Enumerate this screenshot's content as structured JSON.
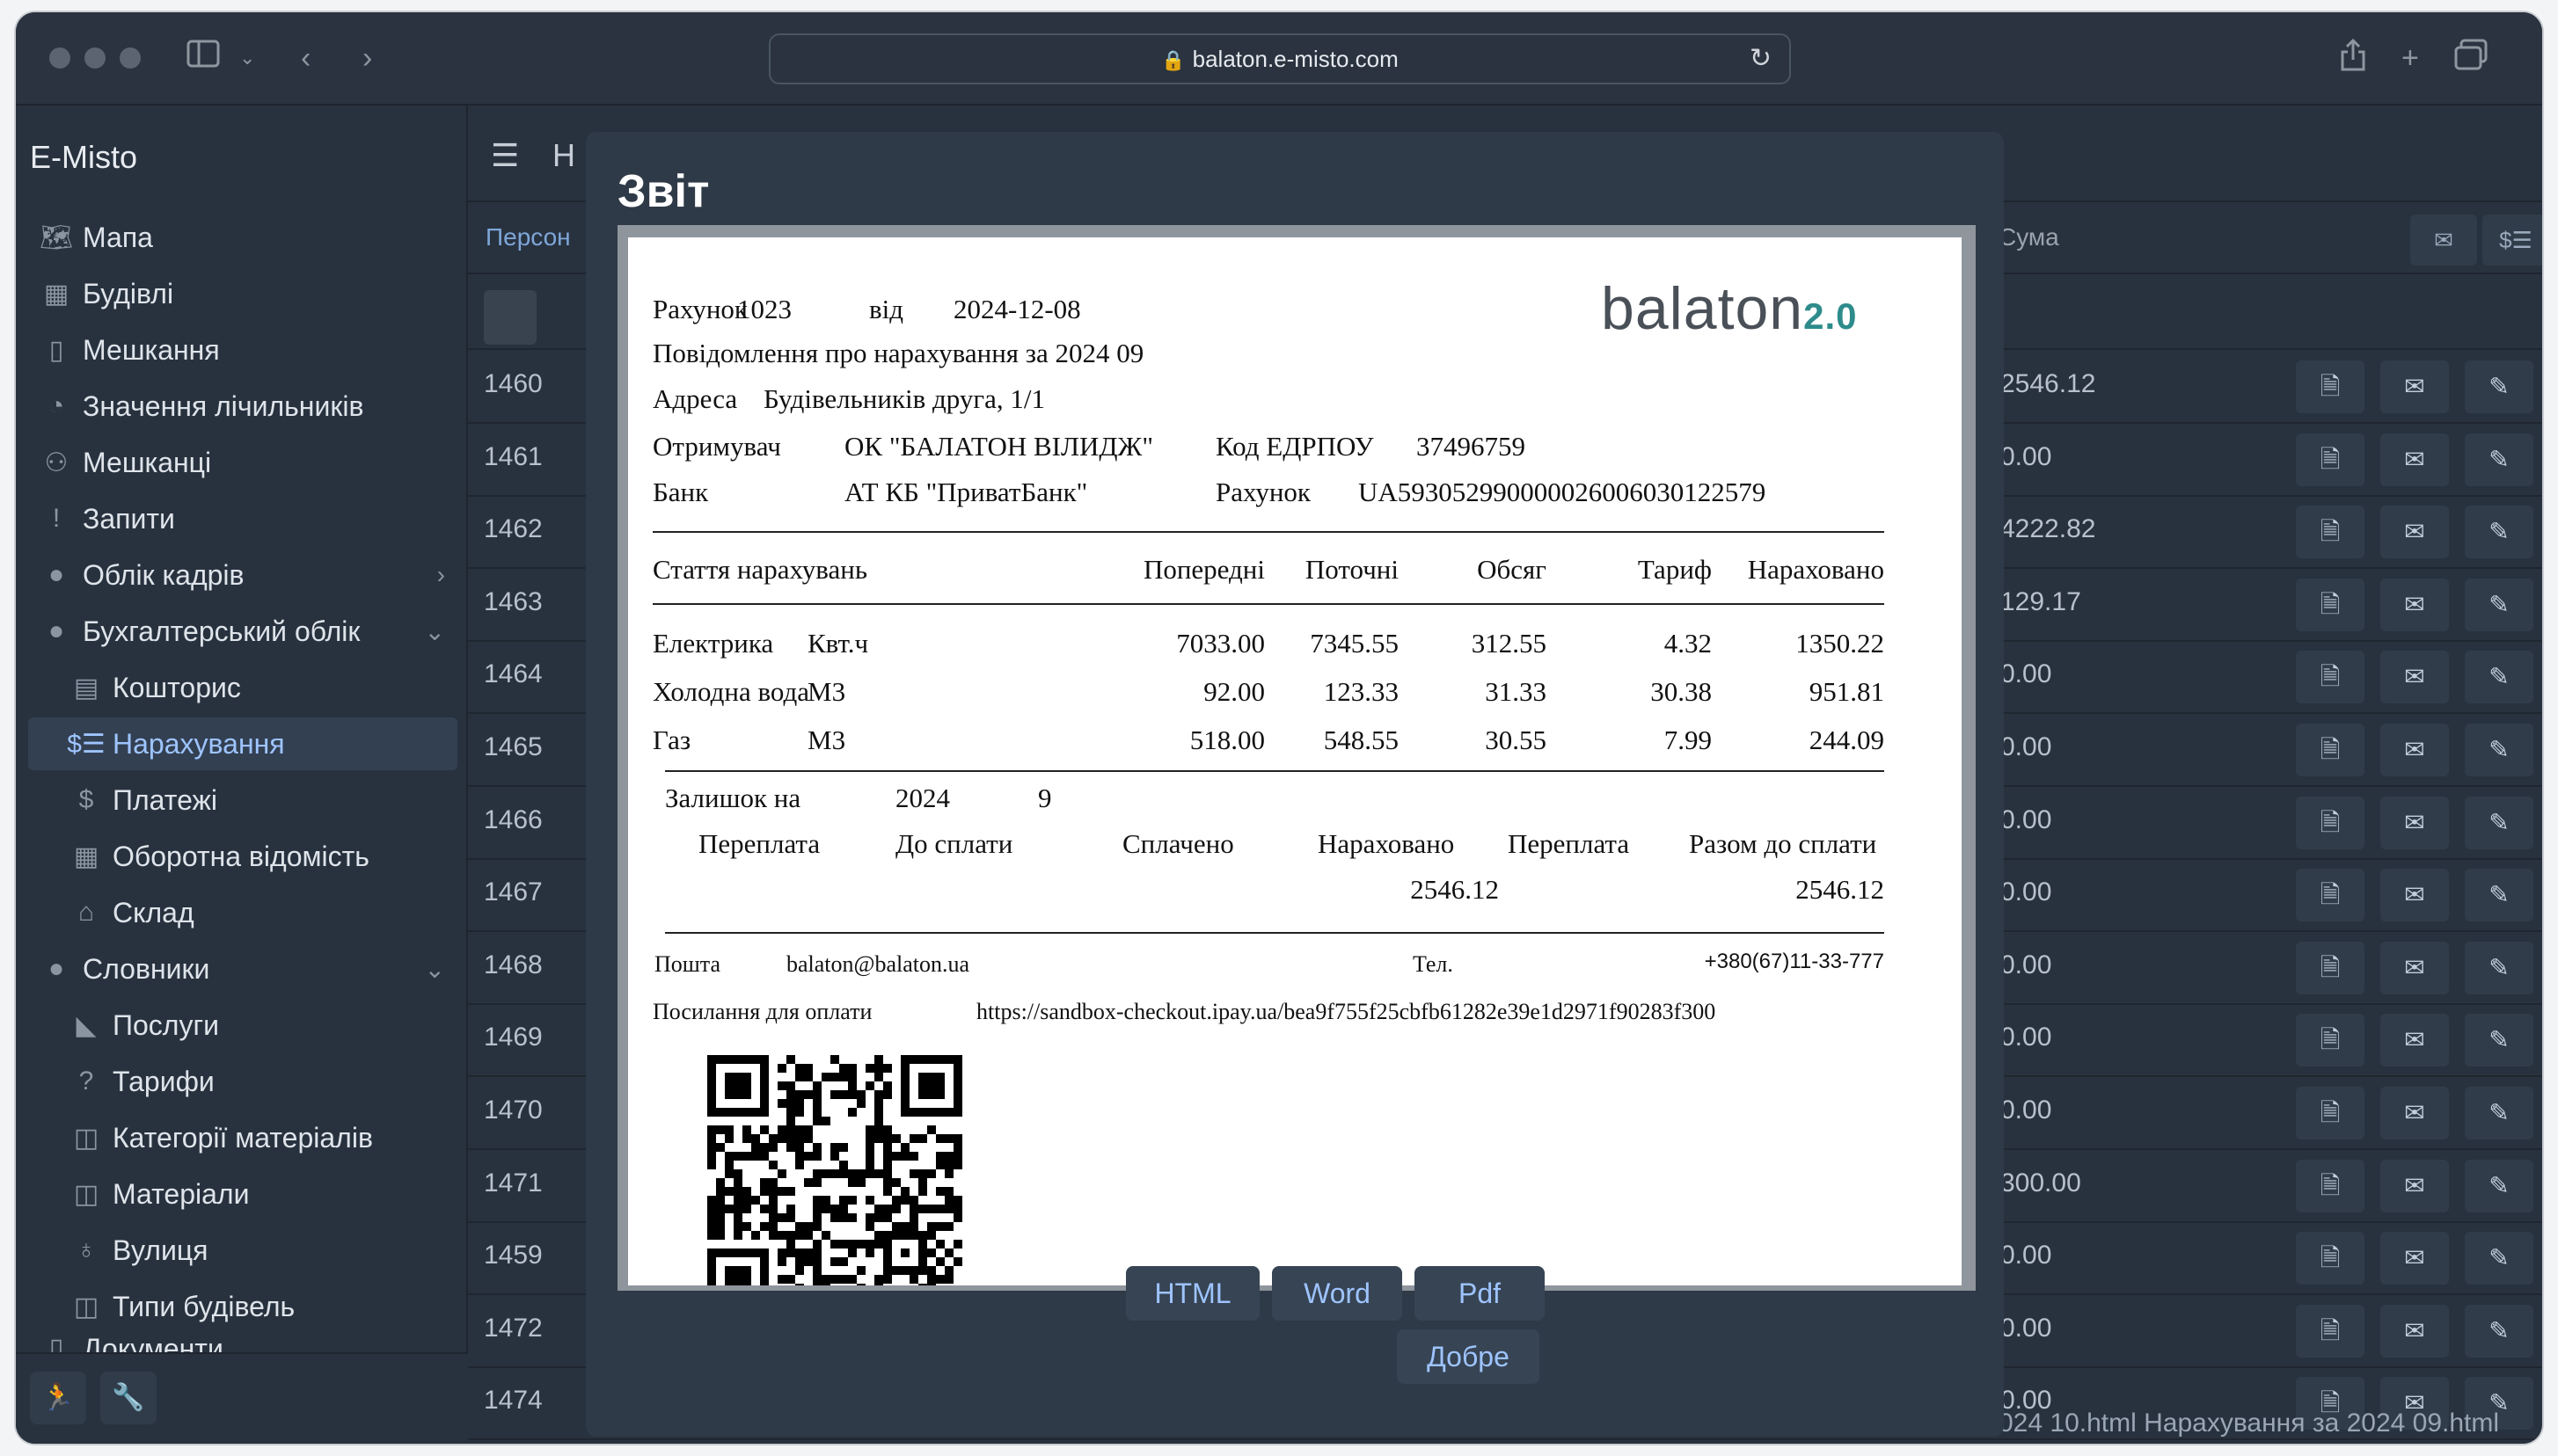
{
  "browser": {
    "url": "balaton.e-misto.com"
  },
  "sidebar": {
    "app_title": "E-Misto",
    "items": [
      {
        "label": "Мапа",
        "icon": "map-icon"
      },
      {
        "label": "Будівлі",
        "icon": "building-icon"
      },
      {
        "label": "Мешкання",
        "icon": "door-icon"
      },
      {
        "label": "Значення лічильників",
        "icon": "gauge-icon"
      },
      {
        "label": "Мешканці",
        "icon": "people-icon"
      },
      {
        "label": "Запити",
        "icon": "exclamation-icon"
      },
      {
        "label": "Облік кадрів",
        "icon": "globe-icon"
      },
      {
        "label": "Бухгалтерський облік",
        "icon": "globe-icon"
      },
      {
        "label": "Кошторис",
        "icon": "estimate-icon"
      },
      {
        "label": "Нарахування",
        "icon": "invoice-icon"
      },
      {
        "label": "Платежі",
        "icon": "dollar-icon"
      },
      {
        "label": "Оборотна відомість",
        "icon": "table-icon"
      },
      {
        "label": "Склад",
        "icon": "warehouse-icon"
      },
      {
        "label": "Словники",
        "icon": "globe-icon"
      },
      {
        "label": "Послуги",
        "icon": "service-icon"
      },
      {
        "label": "Тарифи",
        "icon": "question-icon"
      },
      {
        "label": "Категорії матеріалів",
        "icon": "panel-icon"
      },
      {
        "label": "Матеріали",
        "icon": "panel-icon"
      },
      {
        "label": "Вулиця",
        "icon": "street-icon"
      },
      {
        "label": "Типи будівель",
        "icon": "panel-icon"
      }
    ],
    "partial_item": "Документи"
  },
  "main": {
    "header_partial": "Н",
    "columns": {
      "person": "Персон",
      "sum": "Сума"
    },
    "rows": [
      {
        "id": "1460",
        "sum": "2546.12"
      },
      {
        "id": "1461",
        "sum": "0.00"
      },
      {
        "id": "1462",
        "sum": "4222.82"
      },
      {
        "id": "1463",
        "sum": "129.17"
      },
      {
        "id": "1464",
        "sum": "0.00"
      },
      {
        "id": "1465",
        "sum": "0.00"
      },
      {
        "id": "1466",
        "sum": "0.00"
      },
      {
        "id": "1467",
        "sum": "0.00"
      },
      {
        "id": "1468",
        "sum": "0.00"
      },
      {
        "id": "1469",
        "sum": "0.00"
      },
      {
        "id": "1470",
        "sum": "0.00"
      },
      {
        "id": "1471",
        "sum": "300.00"
      },
      {
        "id": "1459",
        "sum": "0.00"
      },
      {
        "id": "1472",
        "sum": "0.00"
      },
      {
        "id": "1474",
        "sum": "0.00"
      }
    ],
    "status_line": "024 10.html  Нарахування за 2024 09.html"
  },
  "modal": {
    "title": "Звіт",
    "buttons": {
      "html": "HTML",
      "word": "Word",
      "pdf": "Pdf",
      "ok": "Добре"
    }
  },
  "report": {
    "logo_text": "balaton",
    "logo_version": "2.0",
    "invoice_label": "Рахунок",
    "invoice_no": "1023",
    "from_label": "від",
    "date": "2024-12-08",
    "notice": "Повідомлення про нарахування за 2024 09",
    "address_label": "Адреса",
    "address": "Будівельників друга, 1/1",
    "recipient_label": "Отримувач",
    "recipient": "ОК \"БАЛАТОН ВІЛИДЖ\"",
    "edrpou_label": "Код ЕДРПОУ",
    "edrpou": "37496759",
    "bank_label": "Банк",
    "bank": "АТ КБ \"ПриватБанк\"",
    "account_label": "Рахунок",
    "account": "UA593052990000026006030122579",
    "table_headers": [
      "Стаття нарахувань",
      "Попередні",
      "Поточні",
      "Обсяг",
      "Тариф",
      "Нараховано"
    ],
    "charges": [
      {
        "name": "Електрика",
        "unit": "Квт.ч",
        "prev": "7033.00",
        "curr": "7345.55",
        "volume": "312.55",
        "tariff": "4.32",
        "charged": "1350.22"
      },
      {
        "name": "Холодна вода",
        "unit": "М3",
        "prev": "92.00",
        "curr": "123.33",
        "volume": "31.33",
        "tariff": "30.38",
        "charged": "951.81"
      },
      {
        "name": "Газ",
        "unit": "М3",
        "prev": "518.00",
        "curr": "548.55",
        "volume": "30.55",
        "tariff": "7.99",
        "charged": "244.09"
      }
    ],
    "balance_label": "Залишок на",
    "balance_year": "2024",
    "balance_month": "9",
    "balance_headers": [
      "Переплата",
      "До сплати",
      "Сплачено",
      "Нараховано",
      "Переплата",
      "Разом до сплати"
    ],
    "balance_charged": "2546.12",
    "balance_total": "2546.12",
    "email_label": "Пошта",
    "email": "balaton@balaton.ua",
    "phone_label": "Тел.",
    "phone": "+380(67)11-33-777",
    "payment_link_label": "Посилання для оплати",
    "payment_link": "https://sandbox-checkout.ipay.ua/bea9f755f25cbfb61282e39e1d2971f90283f300"
  },
  "colors": {
    "window_bg": "#28323f",
    "accent": "#9ec4ff",
    "active_bg": "#334052",
    "modal_bg": "#2f3a48"
  }
}
